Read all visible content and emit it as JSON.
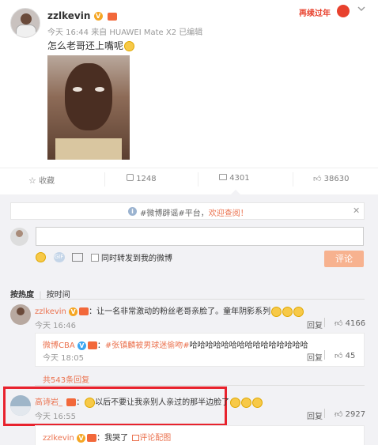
{
  "post": {
    "username": "zzlkevin",
    "meta_time": "今天 16:44",
    "meta_from": "来自",
    "meta_device": "HUAWEI Mate X2",
    "meta_edited": "已编辑",
    "text": "怎么老哥还上嘴呢",
    "banner": "再续过年"
  },
  "actions": {
    "collect": "收藏",
    "repost": "1248",
    "comment": "4301",
    "like": "38630"
  },
  "notice": {
    "text_pre": "#微博辟谣#平台，",
    "text_link": "欢迎查阅！"
  },
  "compose": {
    "placeholder": "",
    "forward_label": "同时转发到我的微博",
    "submit_label": "评论"
  },
  "sort": {
    "hot": "按热度",
    "time": "按时间"
  },
  "comments": [
    {
      "user": "zzlkevin",
      "text": "：让一名非常激动的粉丝老哥亲脸了。童年阴影系列",
      "time": "今天 16:46",
      "reply": "回复",
      "likes": "4166",
      "sub": {
        "user": "微博CBA",
        "hashtag": "#张镇麟被男球迷偷吻#",
        "text": "哈哈哈哈哈哈哈哈哈哈哈哈哈哈哈",
        "time": "今天 18:05",
        "reply": "回复",
        "likes": "45"
      },
      "more": "共543条回复"
    },
    {
      "user": "高诗岩_",
      "text": "以后不要让我亲别人亲过的那半边脸了",
      "time": "今天 16:55",
      "reply": "回复",
      "likes": "2927",
      "sub": {
        "user": "zzlkevin",
        "text": "：我哭了",
        "link": "评论配图"
      }
    }
  ],
  "colors": {
    "accent": "#eb7350",
    "highlight_box": "#e8222d",
    "panel_bg": "#f2f2f5",
    "button_bg": "#f7b28f"
  }
}
